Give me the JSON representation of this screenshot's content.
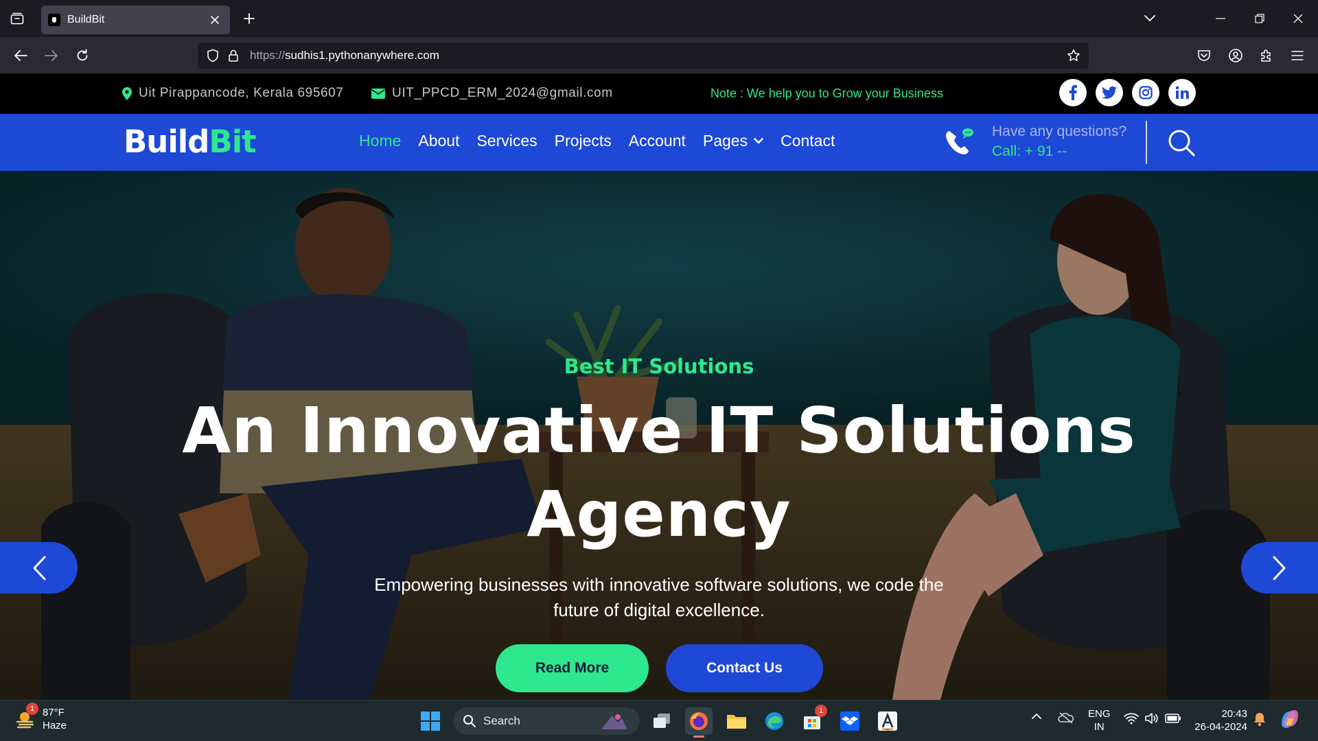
{
  "browser": {
    "tab_title": "BuildBit",
    "url_scheme": "https://",
    "url_host": "sudhis1.pythonanywhere.com"
  },
  "topbar": {
    "address": "Uit Pirappancode, Kerala 695607",
    "email": "UIT_PPCD_ERM_2024@gmail.com",
    "note": "Note : We help you to Grow your Business",
    "socials": [
      "facebook-icon",
      "twitter-icon",
      "instagram-icon",
      "linkedin-icon"
    ]
  },
  "nav": {
    "logo_part1": "Build",
    "logo_part2": "Bit",
    "menu": [
      "Home",
      "About",
      "Services",
      "Projects",
      "Account",
      "Pages",
      "Contact"
    ],
    "active": "Home",
    "question": "Have any questions?",
    "call": "Call: + 91 --"
  },
  "hero": {
    "subtitle": "Best IT Solutions",
    "title": "An Innovative IT Solutions Agency",
    "description": "Empowering businesses with innovative software solutions, we code the future of digital excellence.",
    "read_more": "Read More",
    "contact_us": "Contact Us"
  },
  "taskbar": {
    "weather_badge": "1",
    "temperature": "87°F",
    "condition": "Haze",
    "search_label": "Search",
    "store_badge": "1",
    "lang_line1": "ENG",
    "lang_line2": "IN",
    "time": "20:43",
    "date": "26-04-2024"
  },
  "colors": {
    "accent_green": "#2ee88f",
    "brand_blue": "#1e48d6",
    "topbar_bg": "#000000"
  }
}
